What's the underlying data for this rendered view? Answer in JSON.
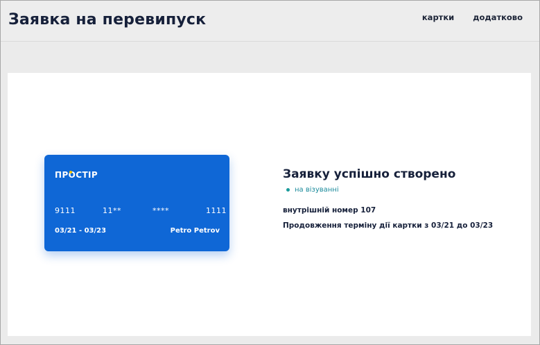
{
  "header": {
    "title": "Заявка на перевипуск",
    "nav": [
      {
        "label": "картки"
      },
      {
        "label": "додатково"
      }
    ]
  },
  "card": {
    "brand_pre": "ПР",
    "brand_o": "О",
    "brand_post": "СТІР",
    "number_groups": [
      "9111",
      "11**",
      "****",
      "1111"
    ],
    "validity": "03/21 - 03/23",
    "holder": "Petro Petrov",
    "color": "#0f67d6"
  },
  "result": {
    "title": "Заявку успішно створено",
    "status": "на візуванні",
    "status_color": "#1a9b9b",
    "internal_number": "внутрішній номер 107",
    "extension": "Продовження терміну дії картки з 03/21 до 03/23"
  }
}
